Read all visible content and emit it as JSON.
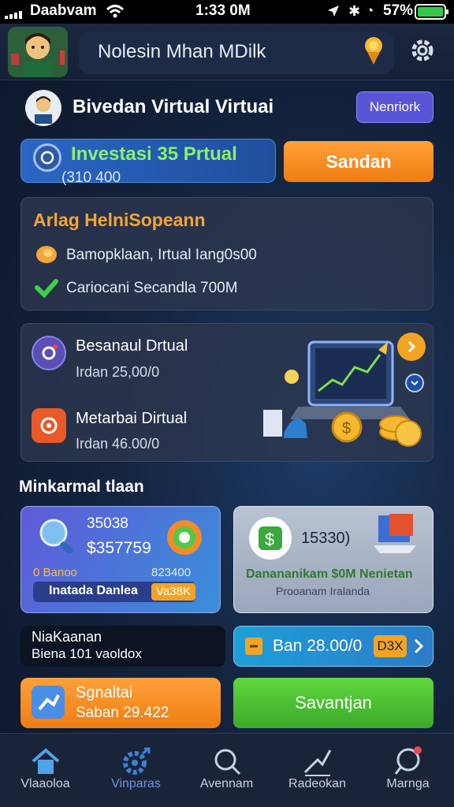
{
  "status_bar": {
    "carrier": "Daabvam",
    "time": "1:33 0M",
    "battery": "57%"
  },
  "header": {
    "title": "Nolesin Mhan MDilk"
  },
  "profile": {
    "name": "Bivedan Virtual Virtuai",
    "action_label": "Nenriork"
  },
  "investment": {
    "title": "Investasi 35 Prtual",
    "amount": "(310 400",
    "button_label": "Sandan"
  },
  "summary": {
    "title": "Arlag HelniSopeann",
    "items": [
      {
        "text": "Bamopklaan, Irtual Iang0s00"
      },
      {
        "text": "Cariocani Secandla 700M"
      }
    ]
  },
  "offers": [
    {
      "title": "Besanaul Drtual",
      "subtitle": "Irdan 25,00/0"
    },
    {
      "title": "Metarbai Dirtual",
      "subtitle": "Irdan 46.00/0"
    }
  ],
  "section": {
    "title": "Minkarmal tlaan"
  },
  "tile_left": {
    "line1": "35038",
    "line2": "$357759",
    "badge_left": "0 Banoo",
    "badge_right": "823400",
    "pill_label": "Inatada Danlea",
    "pill_value": "Va38K"
  },
  "tile_right": {
    "value": "15330)",
    "title": "Danananikam $0M Nenietan",
    "subtitle": "Prooanam Iralanda"
  },
  "row_note": {
    "line1": "NiaKaanan",
    "line2": "Biena 101 vaoldox"
  },
  "row_button": {
    "label": "Ban 28.00/0",
    "badge": "D3X"
  },
  "bottom_cards": {
    "left_title": "Sgnaltai",
    "left_sub": "Saban 29.422",
    "right_label": "Savantjan"
  },
  "nav": {
    "items": [
      {
        "label": "Vlaaoloa"
      },
      {
        "label": "Vinparas"
      },
      {
        "label": "Avennam"
      },
      {
        "label": "Radeokan"
      },
      {
        "label": "Marnga"
      }
    ]
  },
  "colors": {
    "accent_orange": "#f7931e",
    "accent_green": "#4cb83a",
    "accent_blue": "#2a66c4",
    "accent_purple": "#5a55d6",
    "nav_active": "#6f8fe6"
  }
}
